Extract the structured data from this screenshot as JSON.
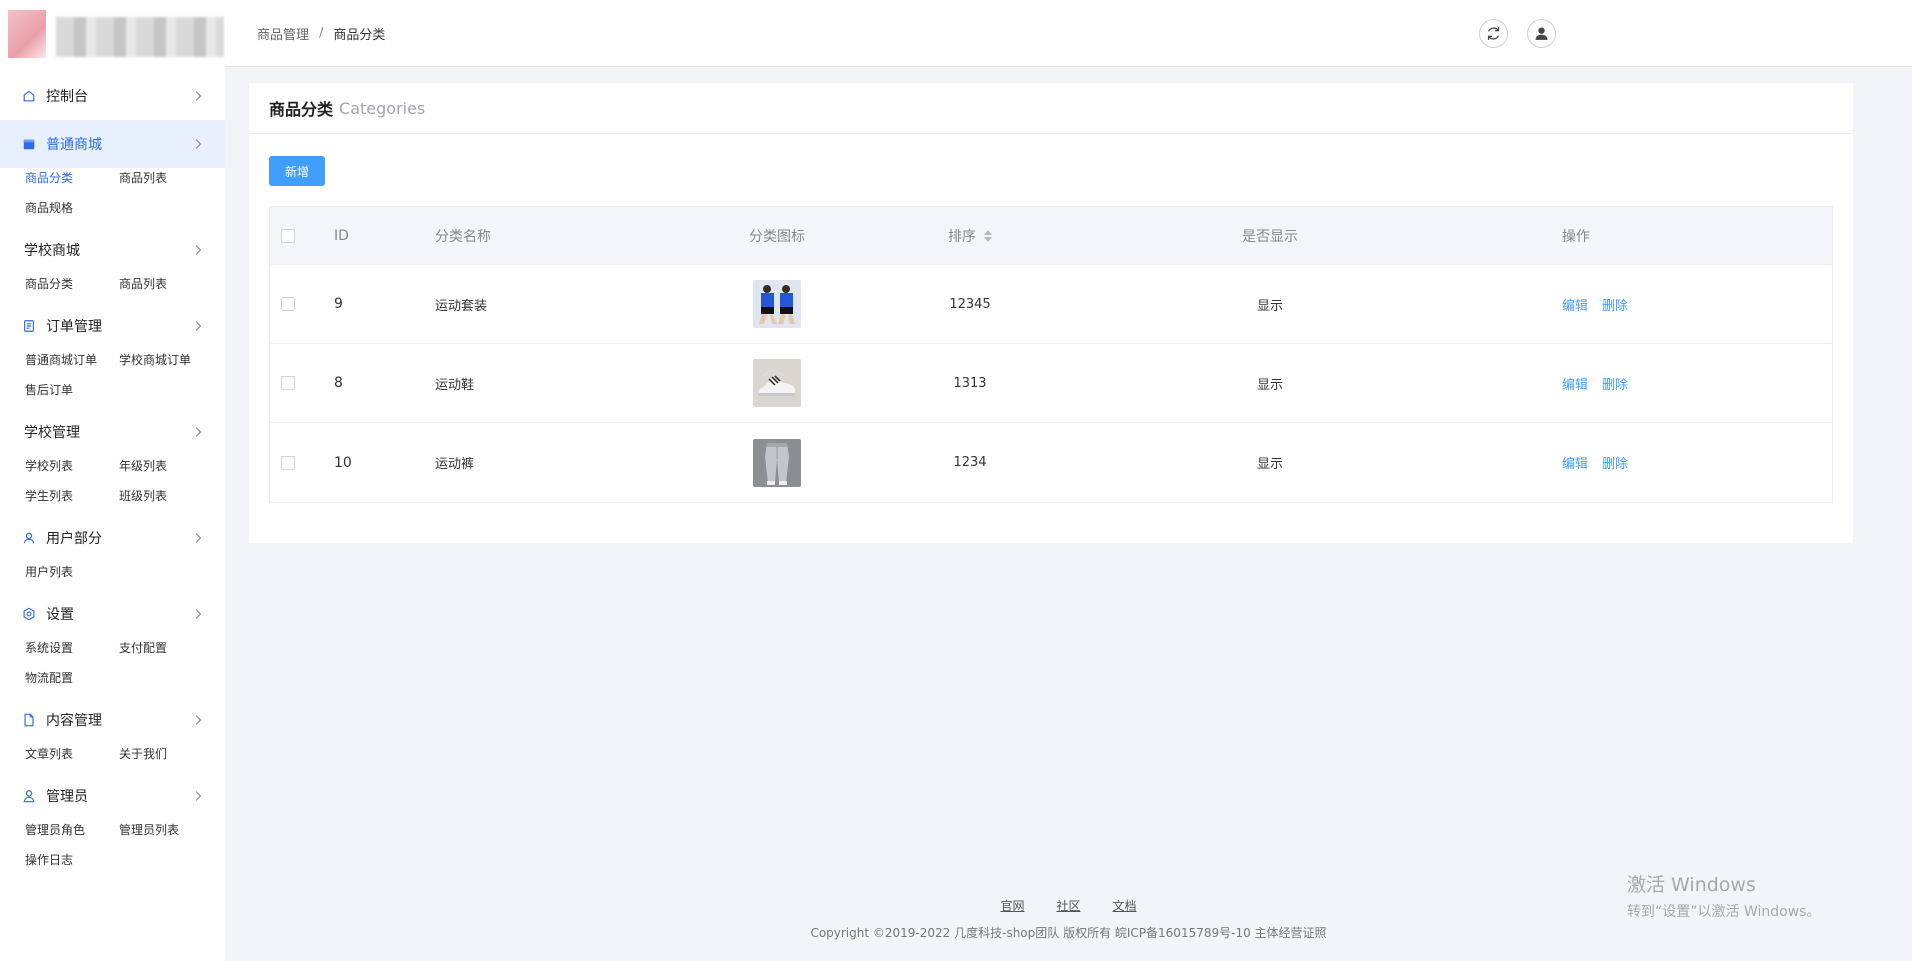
{
  "sidebar": {
    "groups": [
      {
        "label": "控制台",
        "icon": "home-icon",
        "subs": []
      },
      {
        "label": "普通商城",
        "icon": "shop-icon",
        "active": true,
        "subs": [
          "商品分类",
          "商品列表",
          "商品规格"
        ]
      },
      {
        "label": "学校商城",
        "icon": "",
        "subs": [
          "商品分类",
          "商品列表"
        ]
      },
      {
        "label": "订单管理",
        "icon": "order-icon",
        "subs": [
          "普通商城订单",
          "学校商城订单",
          "售后订单"
        ]
      },
      {
        "label": "学校管理",
        "icon": "",
        "subs": [
          "学校列表",
          "年级列表",
          "学生列表",
          "班级列表"
        ]
      },
      {
        "label": "用户部分",
        "icon": "user-icon",
        "subs": [
          "用户列表"
        ]
      },
      {
        "label": "设置",
        "icon": "settings-icon",
        "subs": [
          "系统设置",
          "支付配置",
          "物流配置"
        ]
      },
      {
        "label": "内容管理",
        "icon": "document-icon",
        "subs": [
          "文章列表",
          "关于我们"
        ]
      },
      {
        "label": "管理员",
        "icon": "admin-icon",
        "subs": [
          "管理员角色",
          "管理员列表",
          "操作日志"
        ]
      }
    ],
    "active_sub": "商品分类"
  },
  "header": {
    "breadcrumb": [
      "商品管理",
      "商品分类"
    ],
    "separator": "/"
  },
  "card": {
    "title": "商品分类",
    "subtitle": "Categories",
    "add_button": "新增"
  },
  "table": {
    "columns": {
      "id": "ID",
      "name": "分类名称",
      "icon": "分类图标",
      "sort": "排序",
      "show": "是否显示",
      "op": "操作"
    },
    "rows": [
      {
        "id": "9",
        "name": "运动套装",
        "thumb": "sportswear-thumbnail",
        "sort": "12345",
        "show": "显示",
        "edit": "编辑",
        "delete": "删除"
      },
      {
        "id": "8",
        "name": "运动鞋",
        "thumb": "sneakers-thumbnail",
        "sort": "1313",
        "show": "显示",
        "edit": "编辑",
        "delete": "删除"
      },
      {
        "id": "10",
        "name": "运动裤",
        "thumb": "sweatpants-thumbnail",
        "sort": "1234",
        "show": "显示",
        "edit": "编辑",
        "delete": "删除"
      }
    ]
  },
  "footer": {
    "links": [
      "官网",
      "社区",
      "文档"
    ],
    "copyright": "Copyright ©2019-2022 几度科技-shop团队 版权所有 皖ICP备16015789号-10 主体经营证照"
  },
  "watermark": {
    "line1": "激活 Windows",
    "line2": "转到“设置”以激活 Windows。"
  },
  "colors": {
    "accent": "#409eff",
    "active_menu": "#2e6be6",
    "active_menu_bg": "#e8f0fd",
    "page_bg": "#f2f4f8"
  }
}
